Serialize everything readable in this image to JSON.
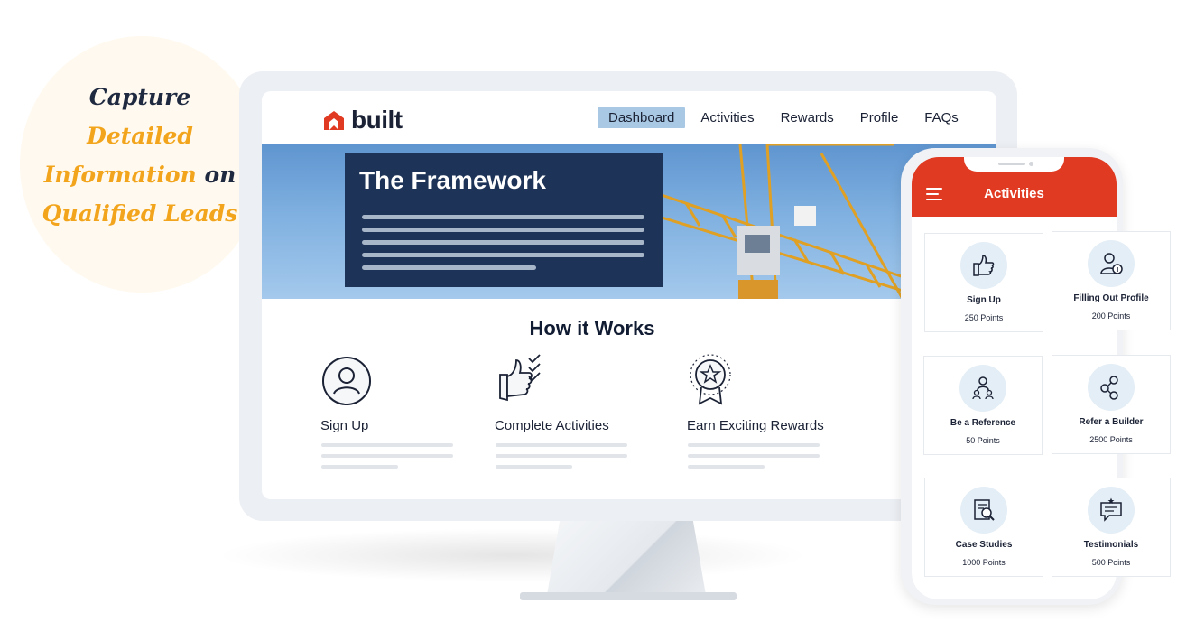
{
  "headline": {
    "line1": "Capture",
    "line2": "Detailed",
    "line3_gold": "Information",
    "line3_dark": " on",
    "line4": "Qualified Leads"
  },
  "site": {
    "logo_text": "built",
    "nav": [
      "Dashboard",
      "Activities",
      "Rewards",
      "Profile",
      "FAQs"
    ],
    "active_nav": "Dashboard",
    "hero_title": "The Framework",
    "section_title": "How it Works",
    "steps": [
      {
        "label": "Sign Up",
        "icon": "user-circle-icon"
      },
      {
        "label": "Complete Activities",
        "icon": "thumbs-up-checklist-icon"
      },
      {
        "label": "Earn Exciting Rewards",
        "icon": "award-badge-icon"
      }
    ]
  },
  "phone": {
    "title": "Activities",
    "cards": [
      {
        "title": "Sign Up",
        "points": "250 Points",
        "icon": "thumbs-up-icon"
      },
      {
        "title": "Filling Out Profile",
        "points": "200 Points",
        "icon": "profile-info-icon"
      },
      {
        "title": "Be a Reference",
        "points": "50 Points",
        "icon": "reference-person-icon"
      },
      {
        "title": "Refer a Builder",
        "points": "2500 Points",
        "icon": "referral-network-icon"
      },
      {
        "title": "Case Studies",
        "points": "1000 Points",
        "icon": "case-study-document-icon"
      },
      {
        "title": "Testimonials",
        "points": "500 Points",
        "icon": "testimonial-chat-icon"
      }
    ]
  },
  "colors": {
    "gold": "#f2a51c",
    "navy": "#1d3357",
    "red": "#e03a22",
    "nav_active": "#a9c8e4"
  }
}
